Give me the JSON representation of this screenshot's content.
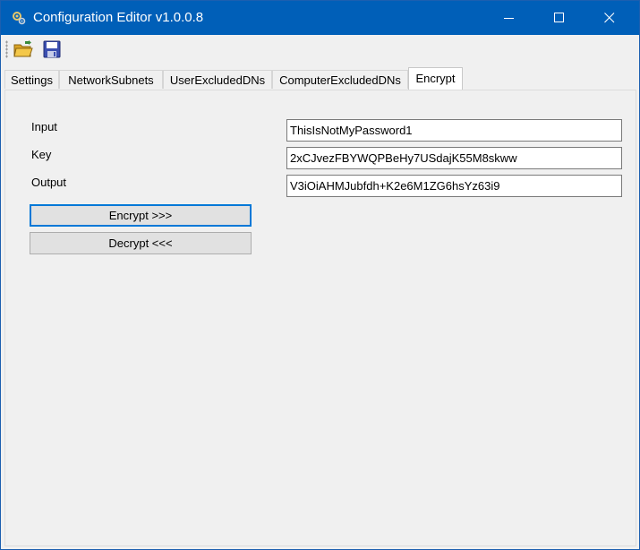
{
  "window": {
    "title": "Configuration Editor v1.0.0.8",
    "icon": "gear-icon",
    "controls": [
      "minimize-icon",
      "maximize-icon",
      "close-icon"
    ]
  },
  "toolbar": {
    "buttons": [
      {
        "icon": "open-folder-icon"
      },
      {
        "icon": "save-icon"
      }
    ]
  },
  "tabs": [
    {
      "label": "Settings",
      "selected": false
    },
    {
      "label": "NetworkSubnets",
      "selected": false
    },
    {
      "label": "UserExcludedDNs",
      "selected": false
    },
    {
      "label": "ComputerExcludedDNs",
      "selected": false
    },
    {
      "label": "Encrypt",
      "selected": true
    }
  ],
  "encrypt": {
    "input_label": "Input",
    "input_value": "ThisIsNotMyPassword1",
    "key_label": "Key",
    "key_value": "2xCJvezFBYWQPBeHy7USdajK55M8skww",
    "output_label": "Output",
    "output_value": "V3iOiAHMJubfdh+K2e6M1ZG6hsYz63i9",
    "encrypt_button": "Encrypt >>>",
    "decrypt_button": "Decrypt <<<"
  },
  "colors": {
    "titlebar": "#005fb8",
    "focus": "#0078d7",
    "background": "#f0f0f0"
  }
}
